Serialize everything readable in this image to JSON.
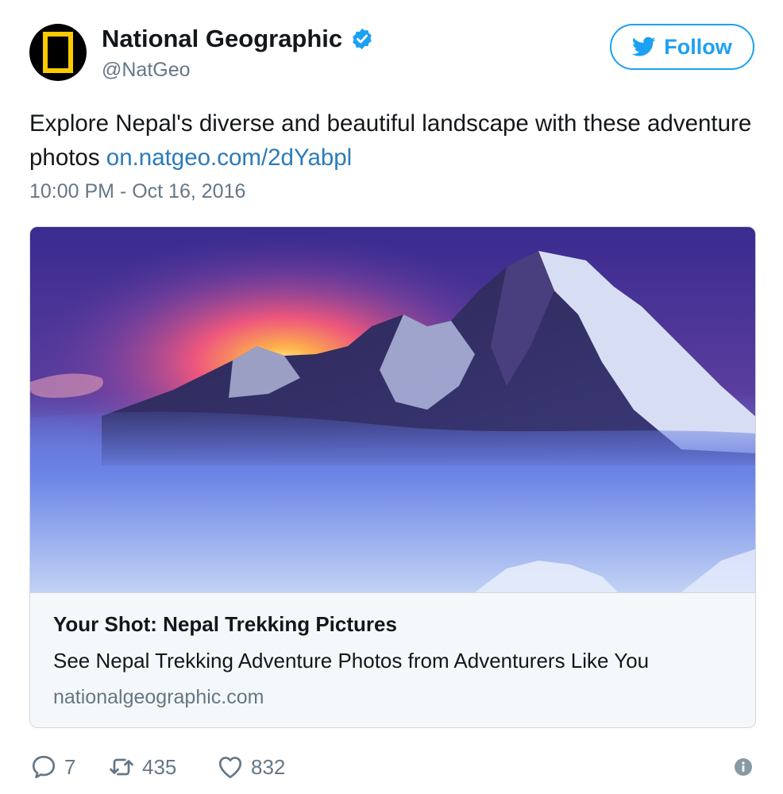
{
  "account": {
    "name": "National Geographic",
    "handle": "@NatGeo",
    "verified": true,
    "avatar_icon": "natgeo-logo-icon"
  },
  "follow": {
    "label": "Follow",
    "icon": "twitter-bird-icon"
  },
  "tweet": {
    "text": "Explore Nepal's diverse and beautiful landscape with these adventure photos ",
    "link": "on.natgeo.com/2dYabpl",
    "timestamp": "10:00 PM - Oct 16, 2016"
  },
  "card": {
    "image_alt_icon": "mountain-photo",
    "title": "Your Shot: Nepal Trekking Pictures",
    "description": "See Nepal Trekking Adventure Photos from Adventurers Like You",
    "domain": "nationalgeographic.com"
  },
  "actions": {
    "reply_count": "7",
    "retweet_count": "435",
    "like_count": "832"
  },
  "colors": {
    "accent": "#1da1f2",
    "link": "#2b7bb9",
    "muted": "#657786",
    "natgeo_yellow": "#f9cb00"
  }
}
